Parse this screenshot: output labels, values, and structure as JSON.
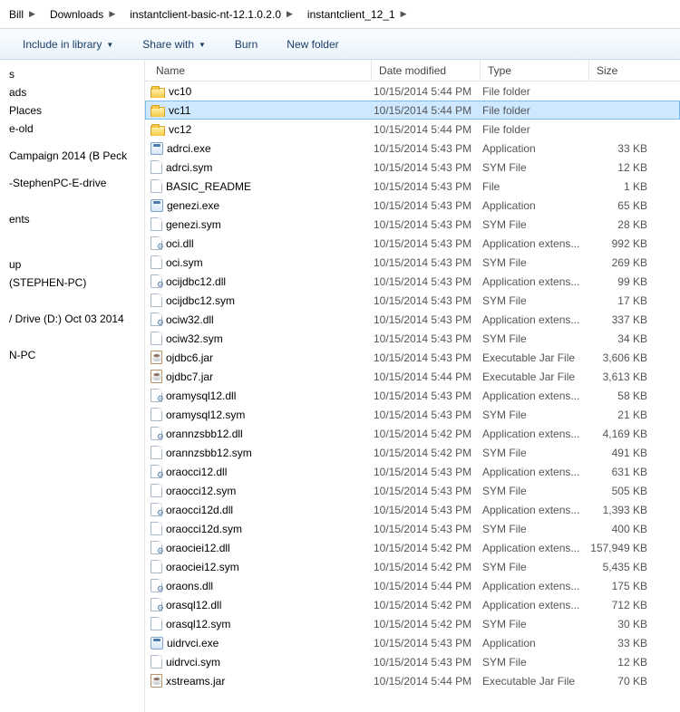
{
  "breadcrumbs": [
    "Bill",
    "Downloads",
    "instantclient-basic-nt-12.1.0.2.0",
    "instantclient_12_1"
  ],
  "toolbar": {
    "include": "Include in library",
    "share": "Share with",
    "burn": "Burn",
    "newfolder": "New folder"
  },
  "columns": {
    "name": "Name",
    "date": "Date modified",
    "type": "Type",
    "size": "Size"
  },
  "nav": [
    "s",
    "ads",
    "Places",
    "e-old",
    "",
    "Campaign 2014 (B Peck",
    "",
    "-StephenPC-E-drive",
    "",
    "",
    "ents",
    "",
    "",
    "",
    "up",
    "(STEPHEN-PC)",
    "",
    "",
    "/ Drive (D:) Oct 03 2014",
    "",
    "",
    "N-PC"
  ],
  "files": [
    {
      "icon": "folder",
      "name": "vc10",
      "date": "10/15/2014 5:44 PM",
      "type": "File folder",
      "size": ""
    },
    {
      "icon": "folder",
      "name": "vc11",
      "date": "10/15/2014 5:44 PM",
      "type": "File folder",
      "size": "",
      "selected": true
    },
    {
      "icon": "folder",
      "name": "vc12",
      "date": "10/15/2014 5:44 PM",
      "type": "File folder",
      "size": ""
    },
    {
      "icon": "app",
      "name": "adrci.exe",
      "date": "10/15/2014 5:43 PM",
      "type": "Application",
      "size": "33 KB"
    },
    {
      "icon": "file",
      "name": "adrci.sym",
      "date": "10/15/2014 5:43 PM",
      "type": "SYM File",
      "size": "12 KB"
    },
    {
      "icon": "file",
      "name": "BASIC_README",
      "date": "10/15/2014 5:43 PM",
      "type": "File",
      "size": "1 KB"
    },
    {
      "icon": "app",
      "name": "genezi.exe",
      "date": "10/15/2014 5:43 PM",
      "type": "Application",
      "size": "65 KB"
    },
    {
      "icon": "file",
      "name": "genezi.sym",
      "date": "10/15/2014 5:43 PM",
      "type": "SYM File",
      "size": "28 KB"
    },
    {
      "icon": "gear",
      "name": "oci.dll",
      "date": "10/15/2014 5:43 PM",
      "type": "Application extens...",
      "size": "992 KB"
    },
    {
      "icon": "file",
      "name": "oci.sym",
      "date": "10/15/2014 5:43 PM",
      "type": "SYM File",
      "size": "269 KB"
    },
    {
      "icon": "gear",
      "name": "ocijdbc12.dll",
      "date": "10/15/2014 5:43 PM",
      "type": "Application extens...",
      "size": "99 KB"
    },
    {
      "icon": "file",
      "name": "ocijdbc12.sym",
      "date": "10/15/2014 5:43 PM",
      "type": "SYM File",
      "size": "17 KB"
    },
    {
      "icon": "gear",
      "name": "ociw32.dll",
      "date": "10/15/2014 5:43 PM",
      "type": "Application extens...",
      "size": "337 KB"
    },
    {
      "icon": "file",
      "name": "ociw32.sym",
      "date": "10/15/2014 5:43 PM",
      "type": "SYM File",
      "size": "34 KB"
    },
    {
      "icon": "jar",
      "name": "ojdbc6.jar",
      "date": "10/15/2014 5:43 PM",
      "type": "Executable Jar File",
      "size": "3,606 KB"
    },
    {
      "icon": "jar",
      "name": "ojdbc7.jar",
      "date": "10/15/2014 5:44 PM",
      "type": "Executable Jar File",
      "size": "3,613 KB"
    },
    {
      "icon": "gear",
      "name": "oramysql12.dll",
      "date": "10/15/2014 5:43 PM",
      "type": "Application extens...",
      "size": "58 KB"
    },
    {
      "icon": "file",
      "name": "oramysql12.sym",
      "date": "10/15/2014 5:43 PM",
      "type": "SYM File",
      "size": "21 KB"
    },
    {
      "icon": "gear",
      "name": "orannzsbb12.dll",
      "date": "10/15/2014 5:42 PM",
      "type": "Application extens...",
      "size": "4,169 KB"
    },
    {
      "icon": "file",
      "name": "orannzsbb12.sym",
      "date": "10/15/2014 5:42 PM",
      "type": "SYM File",
      "size": "491 KB"
    },
    {
      "icon": "gear",
      "name": "oraocci12.dll",
      "date": "10/15/2014 5:43 PM",
      "type": "Application extens...",
      "size": "631 KB"
    },
    {
      "icon": "file",
      "name": "oraocci12.sym",
      "date": "10/15/2014 5:43 PM",
      "type": "SYM File",
      "size": "505 KB"
    },
    {
      "icon": "gear",
      "name": "oraocci12d.dll",
      "date": "10/15/2014 5:43 PM",
      "type": "Application extens...",
      "size": "1,393 KB"
    },
    {
      "icon": "file",
      "name": "oraocci12d.sym",
      "date": "10/15/2014 5:43 PM",
      "type": "SYM File",
      "size": "400 KB"
    },
    {
      "icon": "gear",
      "name": "oraociei12.dll",
      "date": "10/15/2014 5:42 PM",
      "type": "Application extens...",
      "size": "157,949 KB"
    },
    {
      "icon": "file",
      "name": "oraociei12.sym",
      "date": "10/15/2014 5:42 PM",
      "type": "SYM File",
      "size": "5,435 KB"
    },
    {
      "icon": "gear",
      "name": "oraons.dll",
      "date": "10/15/2014 5:44 PM",
      "type": "Application extens...",
      "size": "175 KB"
    },
    {
      "icon": "gear",
      "name": "orasql12.dll",
      "date": "10/15/2014 5:42 PM",
      "type": "Application extens...",
      "size": "712 KB"
    },
    {
      "icon": "file",
      "name": "orasql12.sym",
      "date": "10/15/2014 5:42 PM",
      "type": "SYM File",
      "size": "30 KB"
    },
    {
      "icon": "app",
      "name": "uidrvci.exe",
      "date": "10/15/2014 5:43 PM",
      "type": "Application",
      "size": "33 KB"
    },
    {
      "icon": "file",
      "name": "uidrvci.sym",
      "date": "10/15/2014 5:43 PM",
      "type": "SYM File",
      "size": "12 KB"
    },
    {
      "icon": "jar",
      "name": "xstreams.jar",
      "date": "10/15/2014 5:44 PM",
      "type": "Executable Jar File",
      "size": "70 KB"
    }
  ]
}
